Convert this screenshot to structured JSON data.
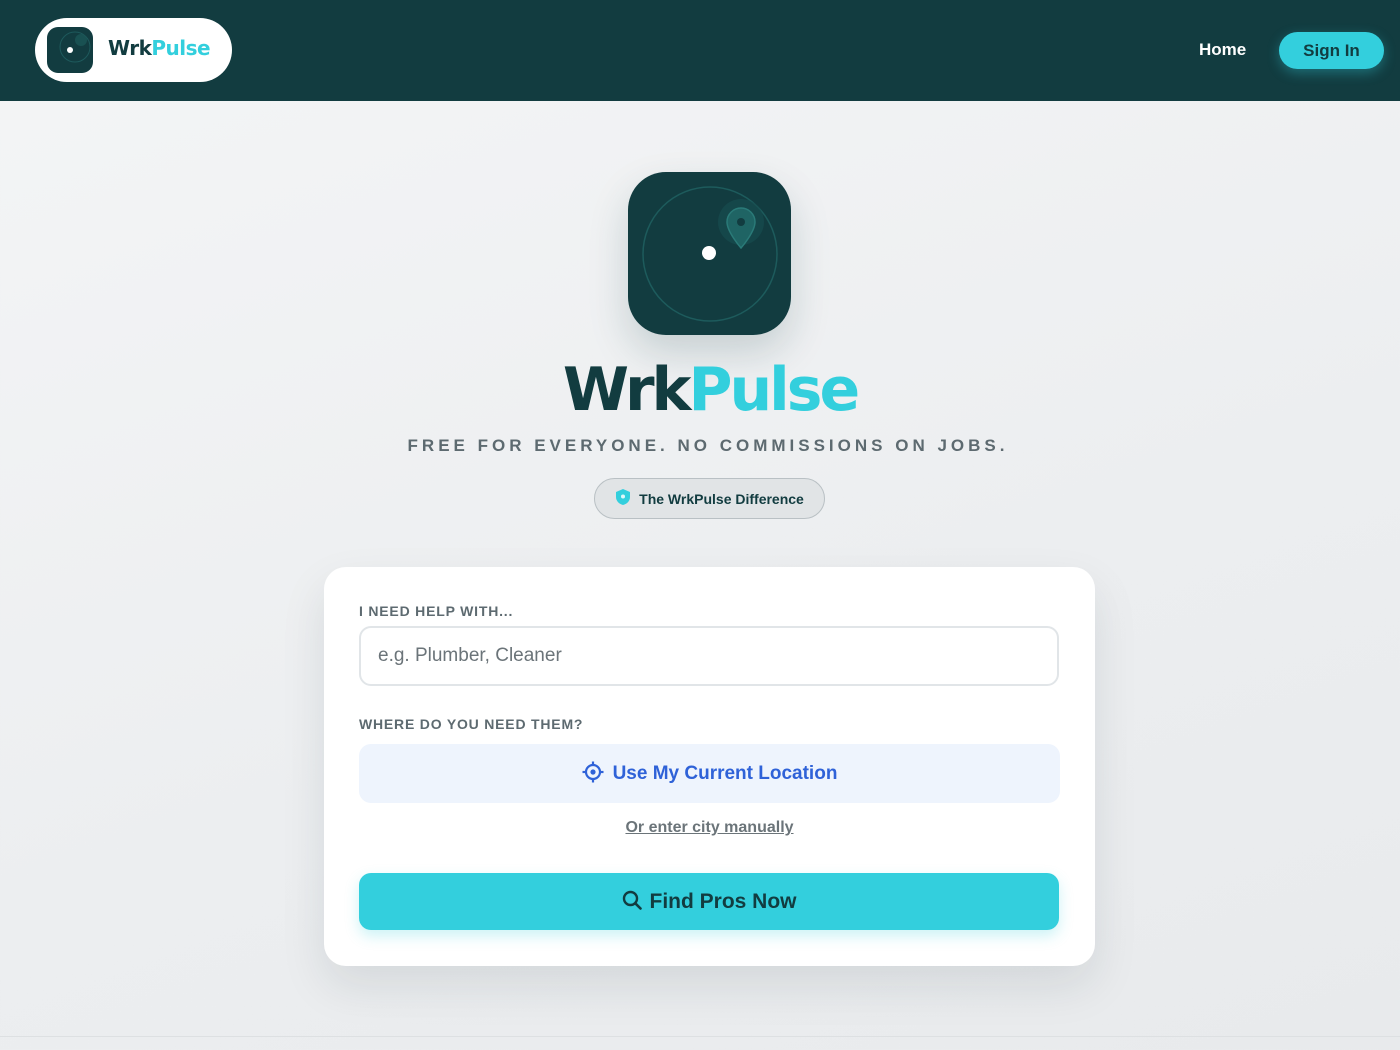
{
  "header": {
    "brand": {
      "name_dark": "Wrk",
      "name_accent": "Pulse"
    },
    "nav_home": "Home",
    "signin_label": "Sign In"
  },
  "hero": {
    "title_dark": "Wrk",
    "title_accent": "Pulse",
    "tagline": "FREE FOR EVERYONE. NO COMMISSIONS ON JOBS.",
    "difference_label": "The WrkPulse Difference",
    "difference_icon": "shield-icon"
  },
  "search": {
    "service_label": "I NEED HELP WITH...",
    "service_placeholder": "e.g. Plumber, Cleaner",
    "service_value": "",
    "location_label": "WHERE DO YOU NEED THEM?",
    "location_button": "Use My Current Location",
    "location_icon": "crosshair-icon",
    "manual_link": "Or enter city manually",
    "find_button": "Find Pros Now",
    "find_icon": "search-icon"
  },
  "colors": {
    "brand_dark": "#123c40",
    "brand_accent": "#33cfdd",
    "link_blue": "#2f62d8",
    "muted_text": "#5d6a70"
  }
}
